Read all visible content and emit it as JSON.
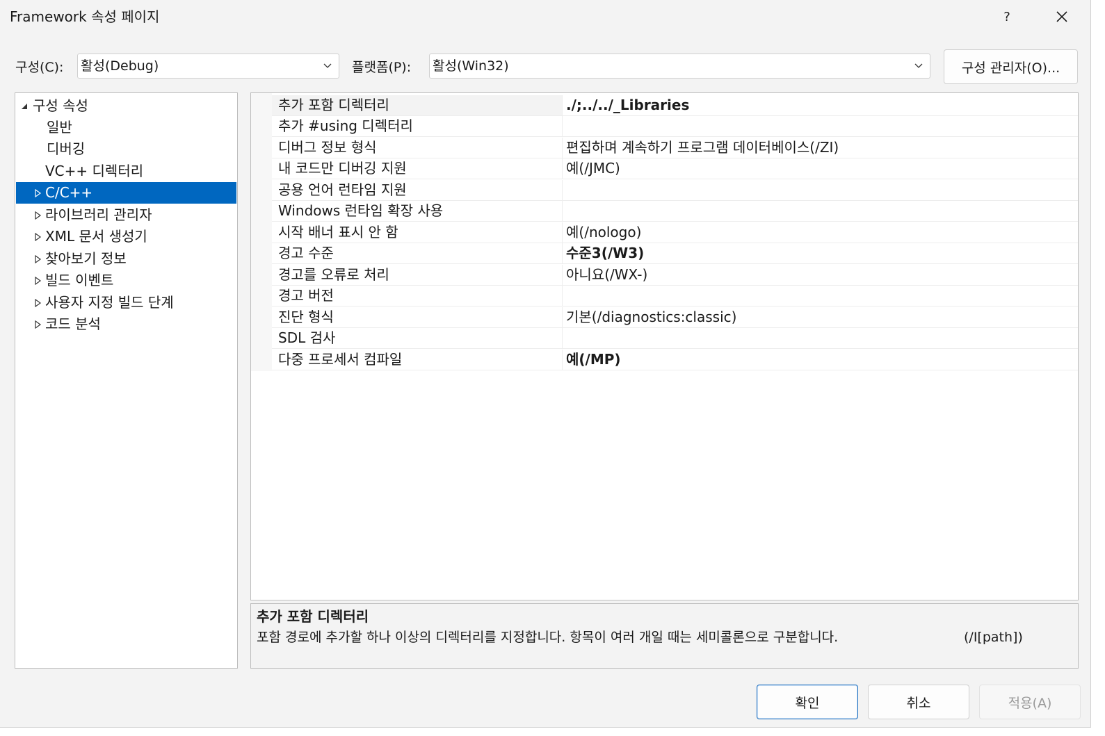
{
  "window": {
    "title": "Framework 속성 페이지",
    "help": "?",
    "close": "✕"
  },
  "toolbar": {
    "config_label": "구성(C):",
    "config_value": "활성(Debug)",
    "platform_label": "플랫폼(P):",
    "platform_value": "활성(Win32)",
    "config_manager": "구성 관리자(O)..."
  },
  "tree": {
    "items": [
      {
        "label": "구성 속성",
        "arrow": "expanded"
      },
      {
        "label": "일반",
        "arrow": "none"
      },
      {
        "label": "디버깅",
        "arrow": "none"
      },
      {
        "label": "VC++ 디렉터리",
        "arrow": "none"
      },
      {
        "label": "C/C++",
        "arrow": "collapsed",
        "selected": true
      },
      {
        "label": "라이브러리 관리자",
        "arrow": "collapsed"
      },
      {
        "label": "XML 문서 생성기",
        "arrow": "collapsed"
      },
      {
        "label": "찾아보기 정보",
        "arrow": "collapsed"
      },
      {
        "label": "빌드 이벤트",
        "arrow": "collapsed"
      },
      {
        "label": "사용자 지정 빌드 단계",
        "arrow": "collapsed"
      },
      {
        "label": "코드 분석",
        "arrow": "collapsed"
      }
    ]
  },
  "grid": {
    "rows": [
      {
        "name": "추가 포함 디렉터리",
        "value": "./;../../_Libraries",
        "bold": true
      },
      {
        "name": "추가 #using 디렉터리",
        "value": ""
      },
      {
        "name": "디버그 정보 형식",
        "value": "편집하며 계속하기 프로그램 데이터베이스(/ZI)"
      },
      {
        "name": "내 코드만 디버깅 지원",
        "value": "예(/JMC)"
      },
      {
        "name": "공용 언어 런타임 지원",
        "value": ""
      },
      {
        "name": "Windows 런타임 확장 사용",
        "value": ""
      },
      {
        "name": "시작 배너 표시 안 함",
        "value": "예(/nologo)"
      },
      {
        "name": "경고 수준",
        "value": "수준3(/W3)",
        "bold": true
      },
      {
        "name": "경고를 오류로 처리",
        "value": "아니요(/WX-)"
      },
      {
        "name": "경고 버전",
        "value": ""
      },
      {
        "name": "진단 형식",
        "value": "기본(/diagnostics:classic)"
      },
      {
        "name": "SDL 검사",
        "value": ""
      },
      {
        "name": "다중 프로세서 컴파일",
        "value": "예(/MP)",
        "bold": true
      }
    ]
  },
  "description": {
    "title": "추가 포함 디렉터리",
    "text": "포함 경로에 추가할 하나 이상의 디렉터리를 지정합니다. 항목이 여러 개일 때는 세미콜론으로 구분합니다.",
    "switch": "(/I[path])"
  },
  "buttons": {
    "ok": "확인",
    "cancel": "취소",
    "apply": "적용(A)"
  },
  "colors": {
    "selection": "#0067c0",
    "dialog_bg": "#f3f3f3",
    "primary_border": "#1e6fbf"
  }
}
